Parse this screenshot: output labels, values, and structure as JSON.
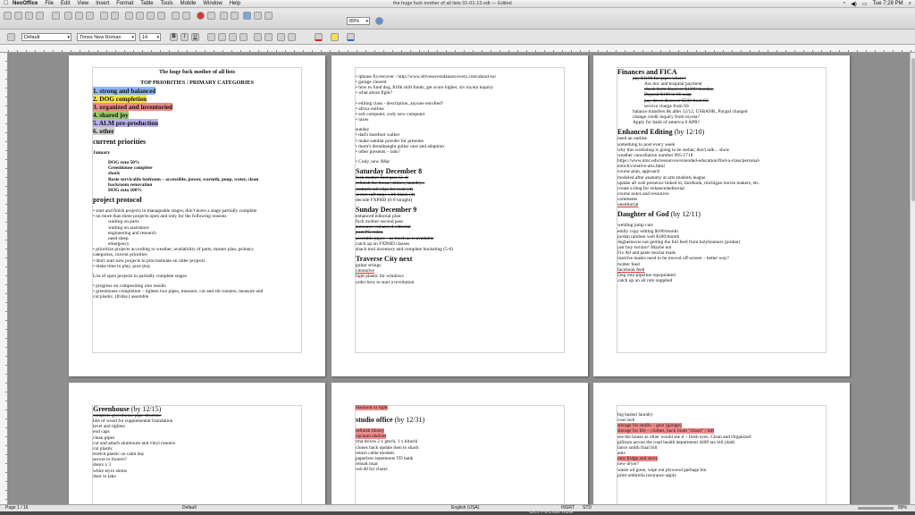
{
  "menubar": {
    "app": "NeoOffice",
    "items": [
      "File",
      "Edit",
      "View",
      "Insert",
      "Format",
      "Table",
      "Tools",
      "Mobile",
      "Window",
      "Help"
    ],
    "doc_title": "the huge fuck mother of all lists 01-01-13.odt — Edited",
    "clock": "Tue 7:28 PM"
  },
  "toolbar": {
    "style": "Default",
    "font": "Times New Roman",
    "size": "14",
    "zoom": "89%",
    "bold": "B",
    "italic": "I",
    "underline": "U"
  },
  "status": {
    "page": "Page 1 / 16",
    "style": "Default",
    "language": "English (USA)",
    "insert": "INSRT",
    "std": "STD",
    "zoom": "89%"
  },
  "page1": {
    "title": "The huge fuck mother of all lists",
    "subtitle": "TOP PRIORITIES / PRIMARY CATEGORIES",
    "categories": [
      "1. strong and balanced",
      "2. DOG completion",
      "3. organized and inventoried",
      "4. shared joy",
      "5. ALM pre-production",
      "6. other"
    ],
    "current_heading": "current priorities",
    "january": "January",
    "jan_items": [
      "DOG roto 50%",
      "Greenhouse complete",
      "shack",
      "Rosie servicable bedroom – accessible, power, warmth, poop, water, clean",
      "backroom renovation",
      "DOG roto 100%"
    ],
    "project_heading": "project protocol",
    "protocol": [
      "• start and finish projects in manageable stages, don't leave a stage partially complete",
      "• no more than three projects open and only for the following reasons",
      "waiting on parts",
      "waiting on assistance",
      "engineering and research",
      "need sleep",
      "emergency",
      "• prioritize projects according to weather, availability of parts, master plan, primary",
      "categories, current priorities",
      "• don't start new projects to procrastinate on older projects",
      "• make time to play, pure play"
    ],
    "list_open": "List of open projects in partially complete stages",
    "open_items": [
      "• progress on compositing roto results",
      "• greenhouse completion – tighten two pipes, measure, cut and slit runners, measure and",
      "cut plastic, (friday) assemble"
    ]
  },
  "page2": {
    "top": [
      "• iphone fix/recover - http://www.drivesaversdatarecovery.com/about-us/",
      "• garage cleared",
      "• how to fund dog, $10k shift funds, get score higher, six toyota inquiry",
      "• what about fight?"
    ],
    "top2": [
      "• editing class - description, anyone enrolled?",
      "• africa outline",
      "• sell computer, cody new computer",
      "• taxes"
    ],
    "sunday": [
      "sunday",
      "• dad's barefoot walker",
      "• make sambar powder for presents",
      "• mom's dreadnaught guitar case and adaption",
      "• other presents – lads?"
    ],
    "cody": "• Cody, new iMac",
    "sat_heading": "Saturday December 8",
    "sat_items": [
      "fuck mother first pass (2-4)",
      "refinish the house, dishes, laundry...",
      "reattach rail clips for rosie (4)",
      "secure raft tarps with blank (4)"
    ],
    "sat_last": "decode FXPHD (6-9 tonight)",
    "sun_heading": "Sunday December 9",
    "sun_items": [
      "enhanced editorial plan",
      "fuck mother second pass"
    ],
    "sun_struck": [
      "announce enhanced editorial",
      "post PG video",
      "assemble pipes – as much as is available"
    ],
    "sun_tail": [
      "catch up on FXPHD classes",
      "shack tool inventory and complete bucketing (5-6)"
    ],
    "trav_heading": "Traverse City next",
    "trav_items": [
      "guitar strings",
      "citrasolve",
      "light plastic for windows",
      "order how to start a revolution"
    ]
  },
  "page3": {
    "fin_heading": "Finances and FICA",
    "fin_struck1": "pay $1100 for pipes where?",
    "fin_ass": "Ass doc and hospital payment",
    "fin_struck2": [
      "check from discover $1000 monday",
      "Deposit $100 in SS asap",
      "pay down discover $500 from SS"
    ],
    "fin_tail1": "service charge from SS",
    "fin_tail": [
      "balance transfers 8k after 12/12, USBANK, Paypal charged",
      "change credit inquiry from toyota?",
      "Apply for bank of america 0 APR?"
    ],
    "ee_heading": "Enhanced Editing",
    "ee_date": "(by 12/10)",
    "ee_items": [
      "need an outline",
      "something to post every week",
      "why this workshop is going to be stellar, don't talk... show",
      "weather cancellation number 995-1718",
      "https://www.nmc.edu/resources/extended-education/find-a-class/personal-",
      "enrich/creative-arts.html",
      "course plan, approach",
      "modeled after anatomy at arts students league",
      "update all web presence linked in, facebook, michigan movie makers, etc.",
      "create a blog for enhancededitorial",
      "course notes and resources",
      "comments",
      "oneditorial"
    ],
    "dog_heading": "Daughter of God",
    "dog_date": "(by 12/11)",
    "dog_items": [
      "welding jump cuts",
      "emily copy editing $100/month",
      "jordan random web $100/month",
      "doghemovie not getting the full feed from holybonners (jordan)",
      "just buy twixtor! Maybe not",
      "Fix All and paste mocha mask",
      "inactive masks need to be moved off-screen – better way?",
      "twitter feed",
      "facebook feed",
      "Dog roto pipeline repopulated",
      "catch up on all roto supplied"
    ]
  },
  "page4": {
    "gh_heading": "Greenhouse",
    "gh_date": "(by 12/15)",
    "gh_struck": "complete greenhouse pipe structure",
    "gh_items": [
      "bits of wood for supplemental foundation",
      "level and tighten",
      "end caps",
      "clean pipes",
      "cut and attach aluminum and vinyl runners",
      "cut plastic",
      "stretch plastic on calm day",
      "secure to footers?",
      "doors x 3",
      "white styro shims",
      "door to lake"
    ]
  },
  "page5": {
    "blackout": "blackout or light",
    "so_heading": "studio office",
    "so_date": "(by 12/31)",
    "so_hl": [
      "refinish library",
      "vacuum shelves"
    ],
    "so_items": [
      "rma drives 2 x gtech, 1 x hitachi",
      "clones back update then to shack",
      "return cable modem",
      "paperless statements TD bank",
      "reload imac",
      "wd-40 for chairs"
    ]
  },
  "page6": {
    "items_a": [
      "big basket laundry",
      "coat rack"
    ],
    "hl_a": [
      "storage for studio – gear (garage)",
      "storage for life – clothes, back room \"closet\" / loft"
    ],
    "items_b": [
      "see the house as other would see it – fresh eyes. Clean and Organized",
      "gillison across the road health department 4409 tax bill (dad)",
      "lance smith final bill",
      "ants"
    ],
    "hl_b": "new fridge and stove",
    "items_c": [
      "new dryer?",
      "waste oil gone, wipe out plywood garbage bin",
      "print umbrella insurance apply"
    ]
  },
  "dock": {
    "hint": "Get Firefox now"
  }
}
